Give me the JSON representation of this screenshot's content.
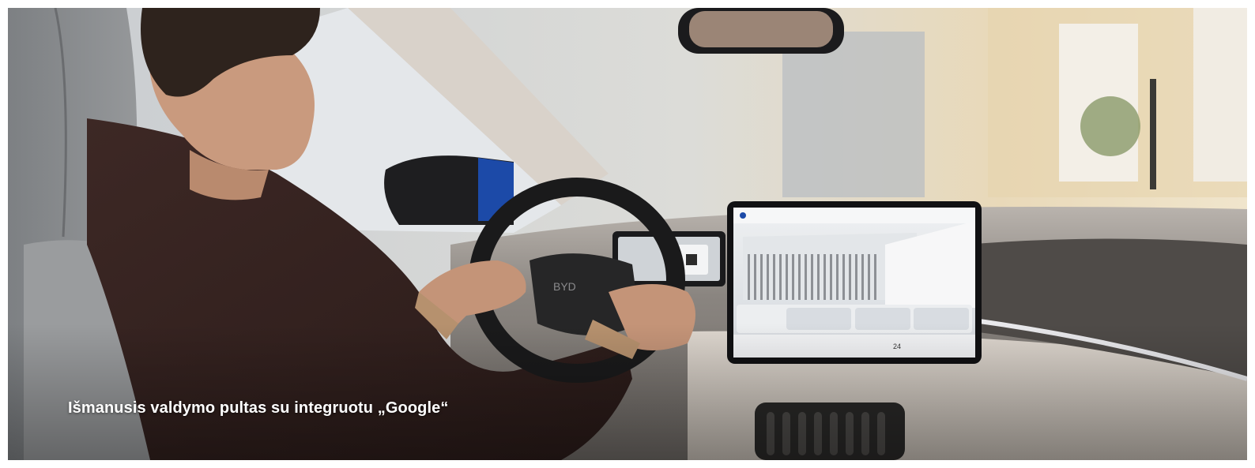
{
  "hero": {
    "caption": "Išmanusis valdymo pultas su integruotu „Google“",
    "wheel_badge": "BYD",
    "screen_time": "24"
  },
  "colors": {
    "background": "#ffffff",
    "caption_text": "#ffffff",
    "seat": "#8a8c8e",
    "jacket": "#3a2623",
    "dashboard": "#d6d0c9",
    "accent_blue": "#1c4aa8"
  }
}
